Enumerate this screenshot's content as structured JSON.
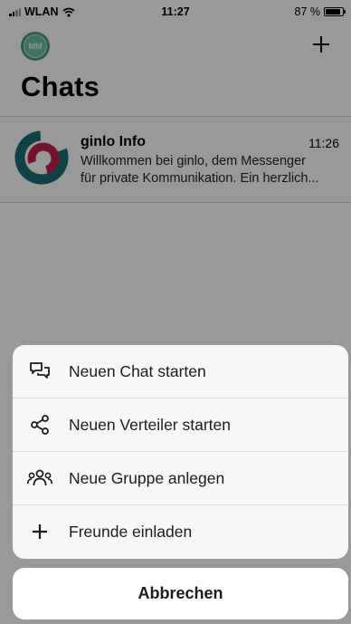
{
  "status_bar": {
    "carrier": "WLAN",
    "time": "11:27",
    "battery": "87 %",
    "battery_level": 0.87
  },
  "header": {
    "avatar_initials": "MM",
    "title": "Chats"
  },
  "chats": [
    {
      "name": "ginlo Info",
      "time": "11:26",
      "preview_line1": "Willkommen bei ginlo, dem Messenger",
      "preview_line2": "für private Kommunikation. Ein herzlich..."
    }
  ],
  "action_sheet": {
    "items": [
      {
        "label": "Neuen Chat starten",
        "icon": "chat-bubbles-icon"
      },
      {
        "label": "Neuen Verteiler starten",
        "icon": "share-nodes-icon"
      },
      {
        "label": "Neue Gruppe anlegen",
        "icon": "group-icon"
      },
      {
        "label": "Freunde einladen",
        "icon": "plus-icon"
      }
    ],
    "cancel_label": "Abbrechen"
  },
  "colors": {
    "avatar_green": "#4a9a82",
    "logo_teal": "#1c6f73",
    "logo_red": "#c4214e",
    "overlay": "rgba(0,0,0,0.4)"
  }
}
